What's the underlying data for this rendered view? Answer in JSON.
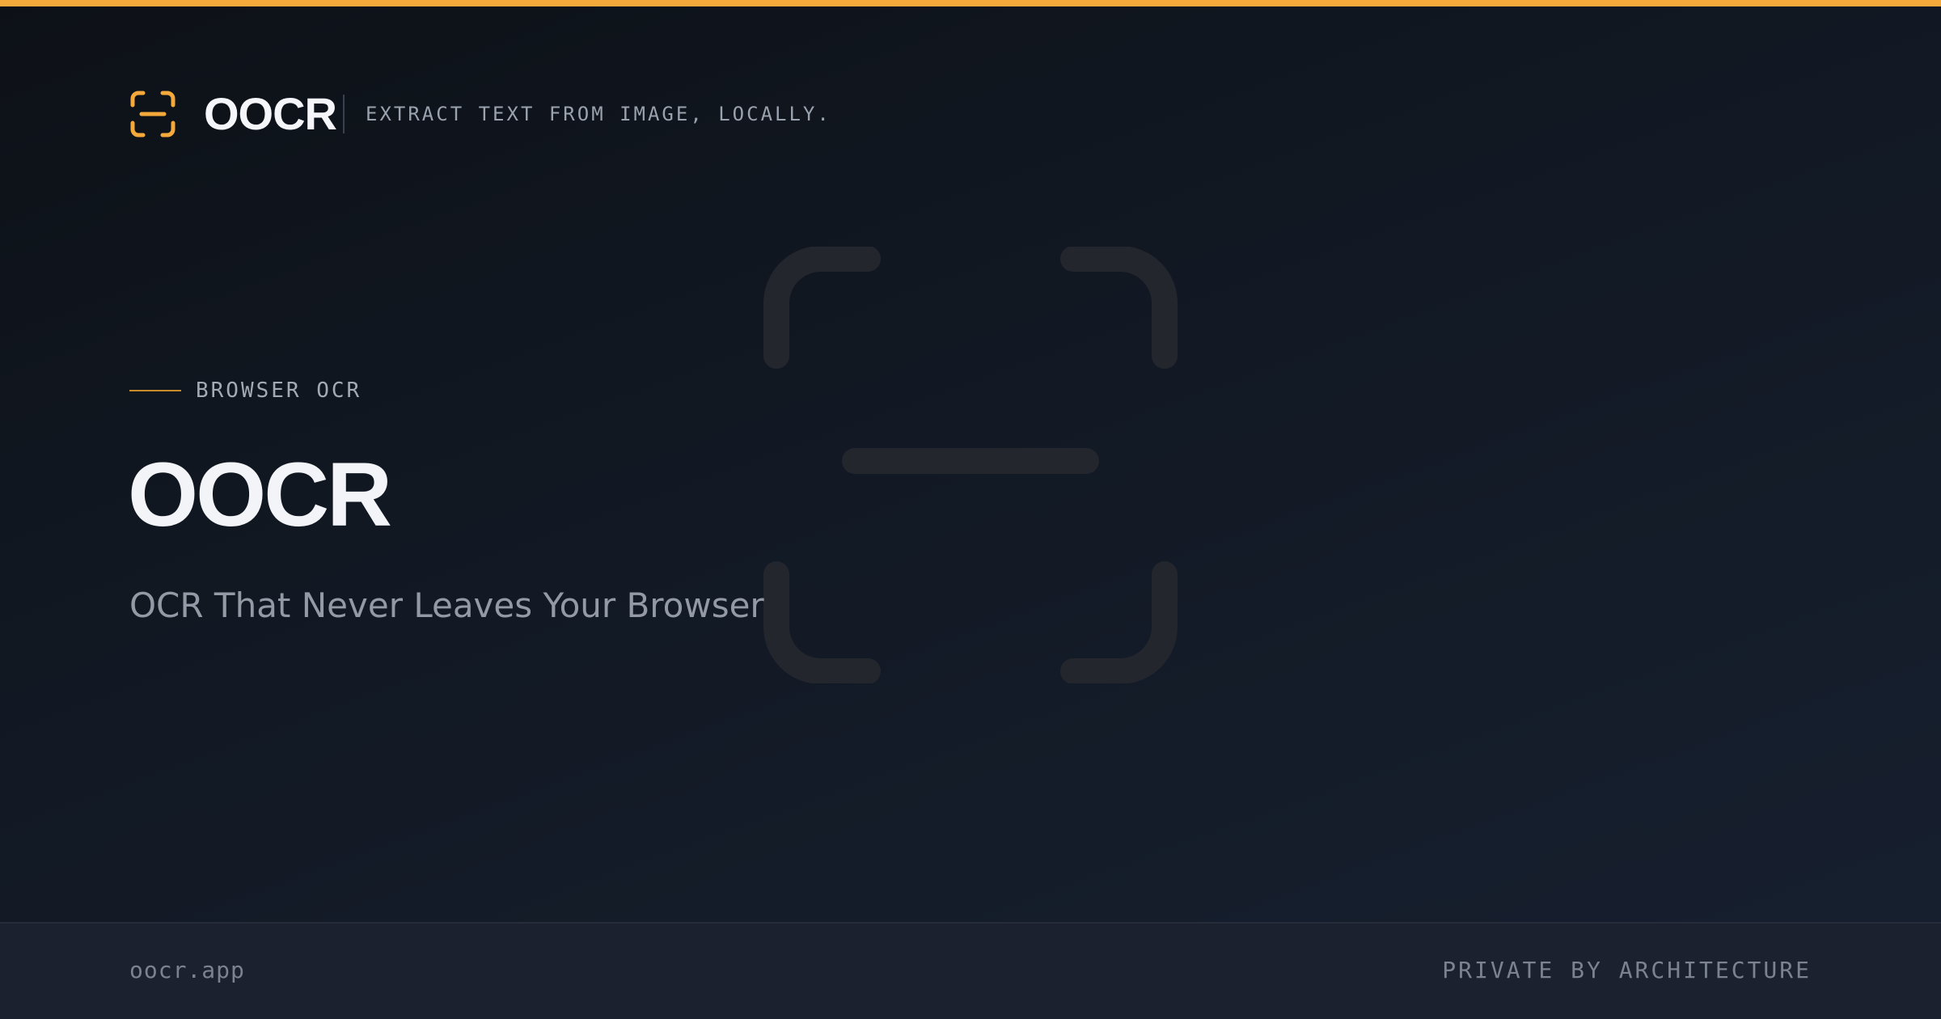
{
  "colors": {
    "accent": "#f5a93a",
    "background": "#121924",
    "footer_background": "#1c2130",
    "text_primary": "#f2f4f8",
    "text_muted": "#939aa6"
  },
  "header": {
    "logo_icon": "scan-text-icon",
    "logo_name": "OOCR",
    "tagline": "EXTRACT TEXT FROM IMAGE, LOCALLY."
  },
  "watermark": {
    "icon": "scan-text-icon"
  },
  "hero": {
    "eyebrow": "BROWSER OCR",
    "title": "OOCR",
    "subtitle": "OCR That Never Leaves Your Browser"
  },
  "footer": {
    "domain": "oocr.app",
    "slogan": "PRIVATE BY ARCHITECTURE"
  }
}
